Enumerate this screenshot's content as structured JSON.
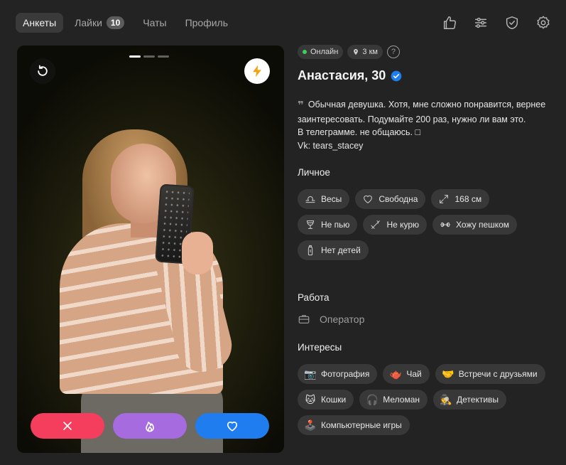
{
  "nav": {
    "tabs": [
      {
        "label": "Анкеты",
        "active": true
      },
      {
        "label": "Лайки",
        "badge": "10"
      },
      {
        "label": "Чаты"
      },
      {
        "label": "Профиль"
      }
    ],
    "icons": [
      "thumbs-up-icon",
      "filters-icon",
      "shield-check-icon",
      "gear-icon"
    ]
  },
  "photo": {
    "slides_total": 3,
    "slide_active": 1,
    "actions": [
      "dislike",
      "superlike",
      "like"
    ]
  },
  "profile": {
    "status_online": "Онлайн",
    "distance": "3 км",
    "help": "?",
    "name": "Анастасия, 30",
    "verified": true,
    "bio": "Обычная девушка. Хотя, мне сложно понравится, вернее заинтересовать. Подумайте 200 раз, нужно ли вам это.\nВ телеграмме. не общаюсь. □\nVk: tears_stacey",
    "personal_title": "Личное",
    "personal": [
      {
        "icon": "libra-icon",
        "label": "Весы"
      },
      {
        "icon": "heart-icon",
        "label": "Свободна"
      },
      {
        "icon": "height-icon",
        "label": "168 см"
      },
      {
        "icon": "glass-icon",
        "label": "Не пью"
      },
      {
        "icon": "no-smoking-icon",
        "label": "Не курю"
      },
      {
        "icon": "dumbbell-icon",
        "label": "Хожу пешком"
      },
      {
        "icon": "baby-bottle-icon",
        "label": "Нет детей"
      }
    ],
    "work_title": "Работа",
    "work": "Оператор",
    "interests_title": "Интересы",
    "interests": [
      {
        "emoji": "📷",
        "label": "Фотография"
      },
      {
        "emoji": "🫖",
        "label": "Чай"
      },
      {
        "emoji": "🤝",
        "label": "Встречи с друзьями"
      },
      {
        "emoji": "🐱",
        "label": "Кошки"
      },
      {
        "emoji": "🎧",
        "label": "Меломан"
      },
      {
        "emoji": "🕵️",
        "label": "Детективы"
      },
      {
        "emoji": "🕹️",
        "label": "Компьютерные игры"
      }
    ]
  },
  "colors": {
    "background": "#232323",
    "pill": "#383838",
    "online": "#3ecf5a",
    "dislike": "#f53d5d",
    "superlike": "#a56bdf",
    "like": "#1f7df0",
    "verified": "#1f7df0",
    "boost": "#f6a20e"
  }
}
